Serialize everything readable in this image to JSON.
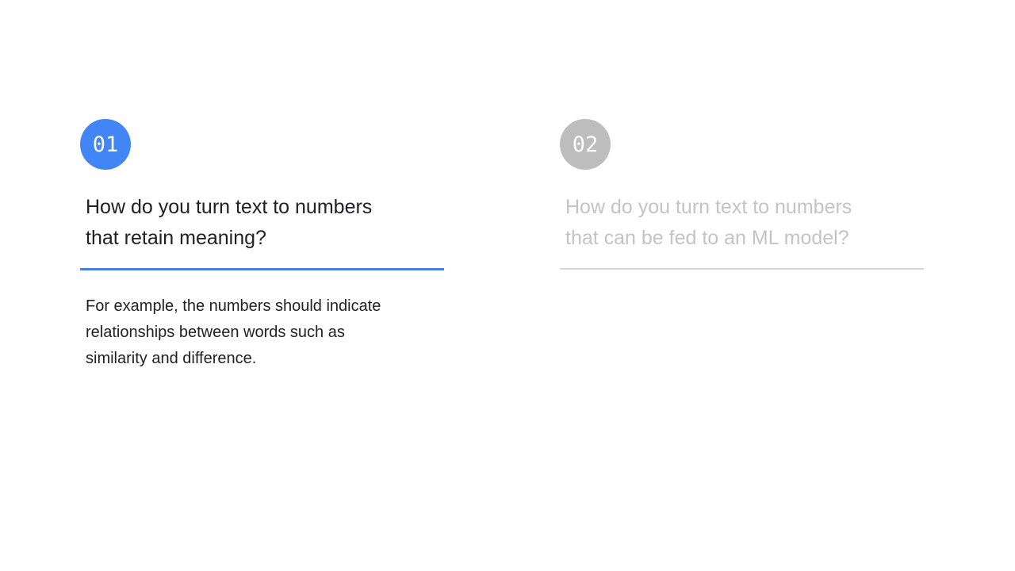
{
  "steps": [
    {
      "number": "01",
      "heading_line1": "How do you turn text to numbers",
      "heading_line2": "that retain meaning?",
      "body_line1": "For example, the numbers should indicate",
      "body_line2": "relationships between words such as",
      "body_line3": "similarity and difference.",
      "state": "active",
      "accent_color": "#4285f4"
    },
    {
      "number": "02",
      "heading_line1": "How do you turn text to numbers",
      "heading_line2": "that can be fed to an ML model?",
      "state": "inactive",
      "accent_color": "#bdbdbd"
    }
  ]
}
